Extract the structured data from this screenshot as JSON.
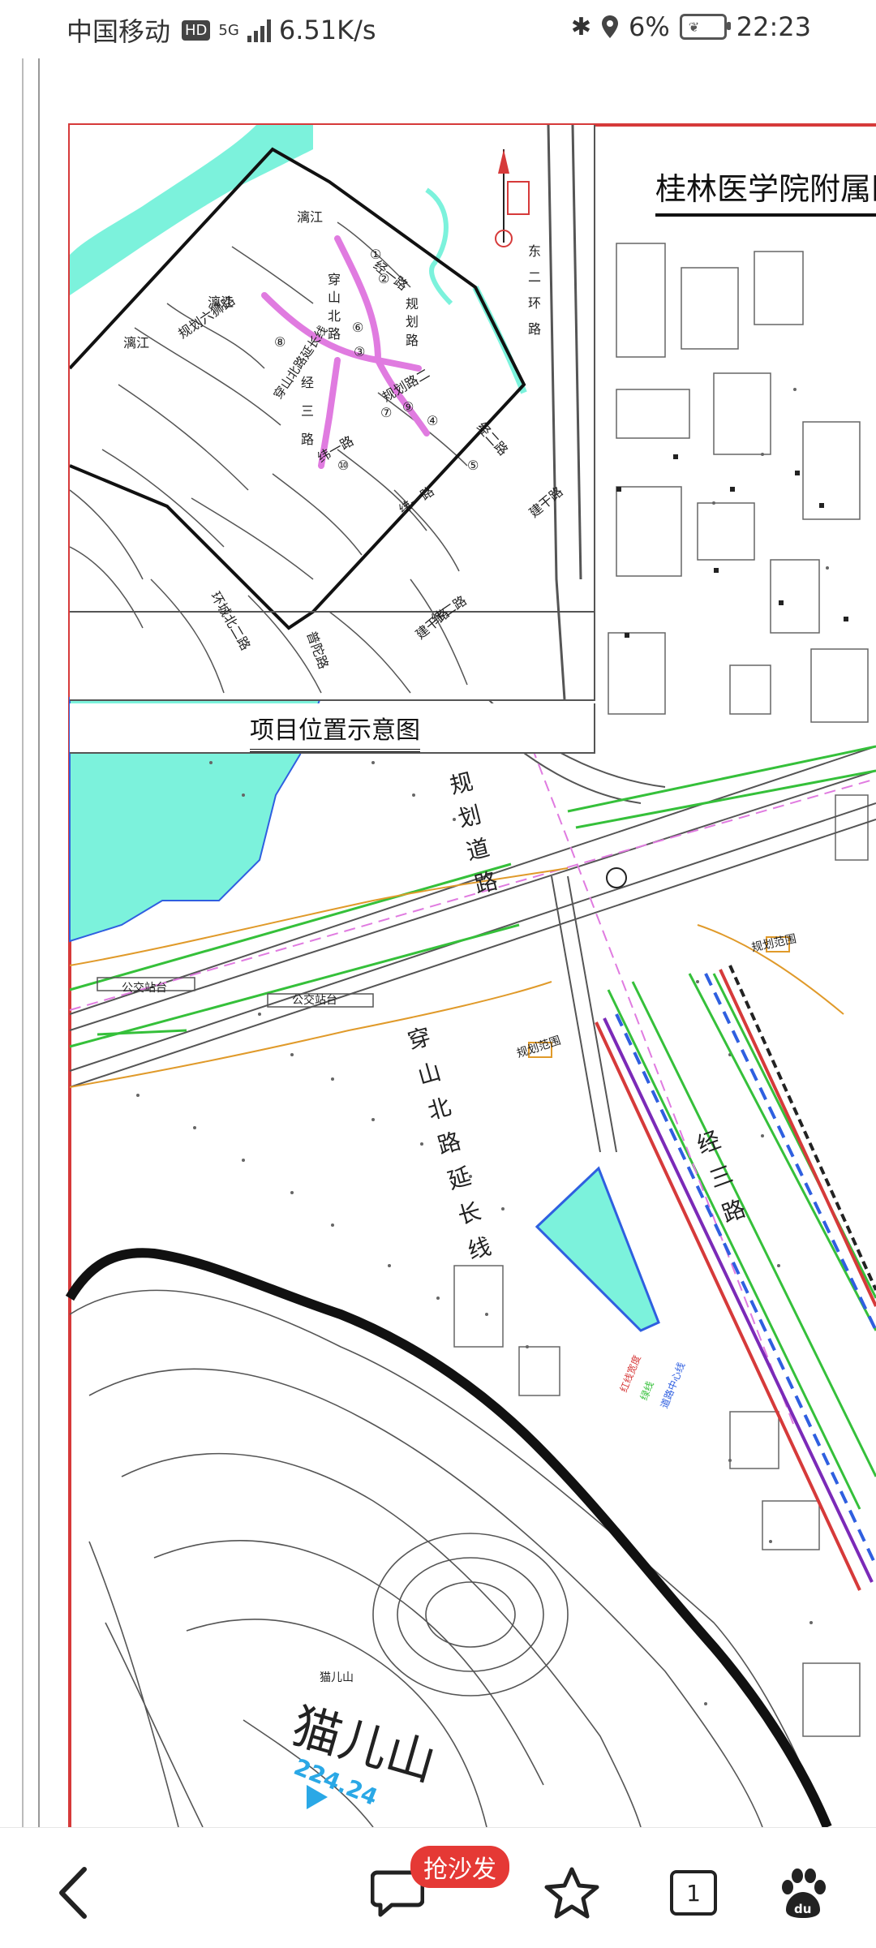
{
  "status_bar": {
    "carrier": "中国移动",
    "hd": "HD",
    "network_type": "5G",
    "speed": "6.51K/s",
    "battery": "6%",
    "time": "22:23"
  },
  "map": {
    "hospital_title": "桂林医学院附属医",
    "inset_title": "项目位置示意图",
    "inset_labels": {
      "lijiang_1": "漓江",
      "lijiang_2": "漓江",
      "lijiang_3": "漓江",
      "road_cheng": "规划六狮路",
      "road_dong2": "东二环路",
      "road_jing1": "经一路",
      "road_jing2": "经二路",
      "road_jing3": "经三路",
      "road_wei1": "纬一路",
      "road_wei2": "纬二路",
      "road_guihua1": "规划路",
      "road_guihua2": "规划路二",
      "road_chuanshan": "穿山北路延长线",
      "road_chuanshan2": "穿山北路",
      "road_huancheng": "环城北二路",
      "road_jiangan": "建干路",
      "road_jiangan2": "建干路",
      "road_hongqiao": "普陀路",
      "n1": "①",
      "n2": "②",
      "n3": "③",
      "n4": "④",
      "n5": "⑤",
      "n6": "⑥",
      "n7": "⑦",
      "n8": "⑧",
      "n9": "⑨",
      "n10": "⑩"
    },
    "main_labels": {
      "planned_road": "规划道路",
      "bus_stop_1": "公交站台",
      "bus_stop_2": "公交站台",
      "chuanshan_ext": "穿山北路延长线",
      "planned_range_1": "规划范围",
      "planned_range_2": "规划范围",
      "jing3": "经三路",
      "mountain": "猫儿山",
      "elevation": "224.24",
      "mountain_small": "猫儿山",
      "legend_1": "红线宽度",
      "legend_2": "绿线",
      "legend_3": "道路中心线"
    },
    "colors": {
      "water": "#7cf2dc",
      "frame": "#d63a3a",
      "planned_road_pink": "#e07be0",
      "green_line": "#35c03a",
      "blue_line": "#2f5fe0",
      "orange_line": "#e09a2a",
      "elev_blue": "#2aa8e6"
    }
  },
  "bottom_nav": {
    "sofa_badge": "抢沙发",
    "tab_count": "1",
    "icons": [
      "back-icon",
      "comment-icon",
      "star-icon",
      "tabs-icon",
      "baidu-paw-icon"
    ]
  }
}
